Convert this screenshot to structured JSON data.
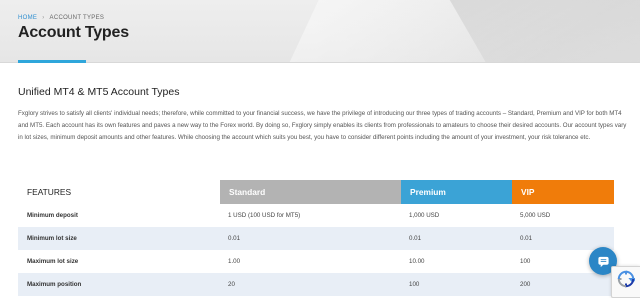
{
  "breadcrumb": {
    "home": "HOME",
    "separator": "›",
    "current": "ACCOUNT TYPES"
  },
  "page": {
    "title": "Account Types"
  },
  "section": {
    "heading": "Unified MT4 & MT5 Account Types",
    "intro": "Fxglory strives to satisfy all clients' individual needs; therefore, while committed to your financial success, we have the privilege of introducing our three types of trading accounts – Standard, Premium and VIP for both MT4 and MT5. Each account has its own features and paves a new way to the Forex world. By doing so, Fxglory simply enables its clients from professionals to amateurs to choose their desired accounts. Our account types vary in lot sizes, minimum deposit amounts and other features. While choosing the account which suits you best, you have to consider different points including the amount of your investment, your risk tolerance etc."
  },
  "table": {
    "headers": {
      "features": "FEATURES",
      "standard": "Standard",
      "premium": "Premium",
      "vip": "VIP"
    },
    "rows": [
      {
        "feature": "Minimum deposit",
        "standard": "1 USD (100 USD for MT5)",
        "premium": "1,000 USD",
        "vip": "5,000 USD"
      },
      {
        "feature": "Minimum lot size",
        "standard": "0.01",
        "premium": "0.01",
        "vip": "0.01"
      },
      {
        "feature": "Maximum lot size",
        "standard": "1.00",
        "premium": "10.00",
        "vip": "100"
      },
      {
        "feature": "Maximum position",
        "standard": "20",
        "premium": "100",
        "vip": "200"
      }
    ]
  },
  "colors": {
    "accent": "#2fa6db",
    "standard": "#b3b3b3",
    "premium": "#3ba3d6",
    "vip": "#f07c0a",
    "row_alt": "#e8eef6"
  },
  "widgets": {
    "chat_icon": "chat-bubble-icon",
    "recaptcha_icon": "recaptcha-icon"
  }
}
